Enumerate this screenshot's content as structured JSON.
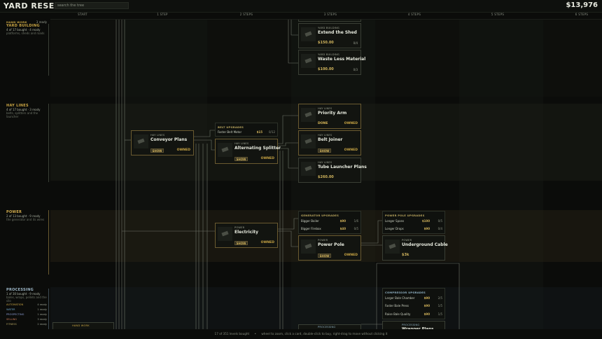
{
  "app": {
    "title": "YARD RESEARCH",
    "search_placeholder": "search the tree",
    "money": "$13,976"
  },
  "columns": [
    "START",
    "1 STEP",
    "2 STEPS",
    "3 STEPS",
    "4 STEPS",
    "5 STEPS",
    "6 STEPS"
  ],
  "sidebar": {
    "top_label": "HAND WORK",
    "top_ready": "3 ready",
    "sections": [
      {
        "name": "YARD BUILDING",
        "count": "4 of 17 bought · 4 ready",
        "desc": "platforms, sheds and roads",
        "color": "#c9a544"
      },
      {
        "name": "HAY LINES",
        "count": "4 of 17 bought · 3 ready",
        "desc": "belts, splitters and the launcher",
        "color": "#c9a544"
      },
      {
        "name": "POWER",
        "count": "2 of 13 bought · 9 ready",
        "desc": "the generator and its wires",
        "color": "#c9a544"
      },
      {
        "name": "PROCESSING",
        "count": "1 of 30 bought · 9 ready",
        "desc": "bales, wraps, pellets and the silo",
        "color": "#9eb8c9"
      }
    ],
    "categories": [
      {
        "name": "AUTOMATION",
        "ready": "4 ready",
        "color": "#c9a544"
      },
      {
        "name": "WATER",
        "ready": "1 ready",
        "color": "#6fa6c9"
      },
      {
        "name": "PROSPECTING",
        "ready": "1 ready",
        "color": "#8a9ad0"
      },
      {
        "name": "SELLING",
        "ready": "3 ready",
        "color": "#c97a5a"
      },
      {
        "name": "FITNESS",
        "ready": "2 ready",
        "color": "#b0a060"
      }
    ]
  },
  "cards": {
    "extend_shed": {
      "cat": "YARD BUILDING",
      "name": "Extend the Shed",
      "price": "$150.00",
      "level": "0/4"
    },
    "waste_less": {
      "cat": "YARD BUILDING",
      "name": "Waste Less Material",
      "price": "$100.00",
      "level": "0/3"
    },
    "priority_arm": {
      "cat": "HAY LINES",
      "name": "Priority Arm",
      "status": "DONE",
      "owned": "OWNED"
    },
    "belt_joiner": {
      "cat": "HAY LINES",
      "name": "Belt Joiner",
      "show": "SHOW",
      "owned": "OWNED"
    },
    "tube_launcher": {
      "cat": "HAY LINES",
      "name": "Tube Launcher Plans",
      "price": "$260.00"
    },
    "conveyor": {
      "cat": "HAY LINES",
      "name": "Conveyor Plans",
      "show": "SHOW",
      "owned": "OWNED"
    },
    "splitter": {
      "cat": "HAY LINES",
      "name": "Alternating Splitter",
      "show": "SHOW",
      "owned": "OWNED"
    },
    "electricity": {
      "cat": "POWER",
      "name": "Electricity",
      "show": "SHOW",
      "owned": "OWNED"
    },
    "power_pole": {
      "cat": "POWER",
      "name": "Power Pole",
      "show": "SHOW",
      "owned": "OWNED"
    },
    "underground": {
      "cat": "POWER",
      "name": "Underground Cable",
      "price": "$3k"
    },
    "hand_work": {
      "cat": "HAND WORK"
    },
    "processing_card": {
      "cat": "PROCESSING"
    },
    "wrap_card": {
      "cat": "PROCESSING",
      "name": "Wrapper Plans"
    }
  },
  "groups": {
    "belt": {
      "title": "BELT UPGRADES",
      "rows": [
        {
          "name": "Faster Belt Motor",
          "price": "$15",
          "level": "0/12"
        }
      ]
    },
    "generator": {
      "title": "GENERATOR UPGRADES",
      "rows": [
        {
          "name": "Bigger Boiler",
          "price": "$90",
          "level": "1/6"
        },
        {
          "name": "Bigger Firebox",
          "price": "$40",
          "level": "0/5"
        }
      ]
    },
    "pole": {
      "title": "POWER POLE UPGRADES",
      "rows": [
        {
          "name": "Longer Spans",
          "price": "$100",
          "level": "0/5"
        },
        {
          "name": "Longer Drops",
          "price": "$90",
          "level": "0/4"
        }
      ]
    },
    "compressor": {
      "title": "COMPRESSOR UPGRADES",
      "rows": [
        {
          "name": "Larger Bale Chamber",
          "price": "$90",
          "level": "2/5"
        },
        {
          "name": "Faster Bale Press",
          "price": "$90",
          "level": "1/5"
        },
        {
          "name": "Raise Bale Quality",
          "price": "$90",
          "level": "1/5"
        }
      ]
    }
  },
  "footer": {
    "levels": "17 of 351 levels bought",
    "help": "wheel to zoom, click a card, double-click to buy, right-drag to move without clicking it"
  }
}
